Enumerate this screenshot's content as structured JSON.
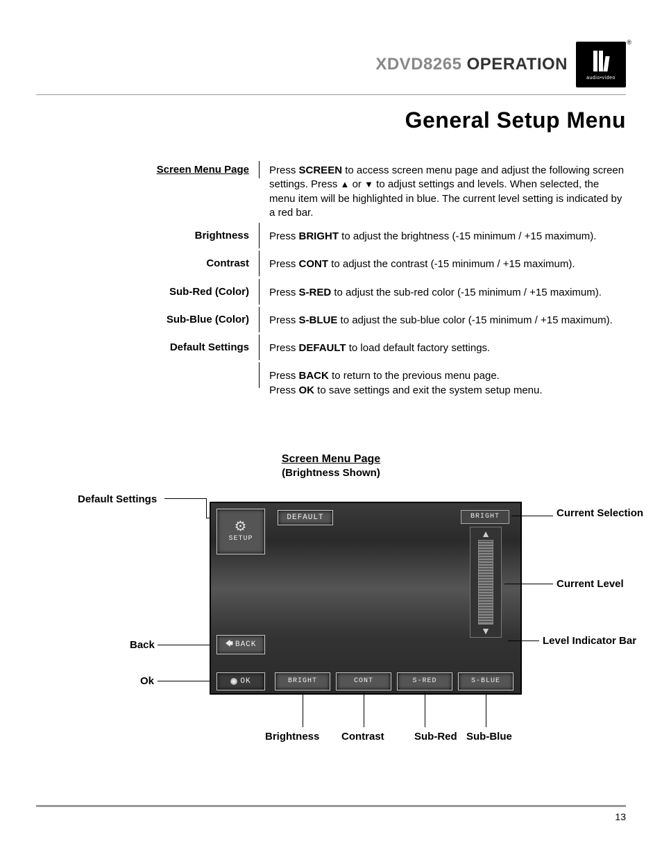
{
  "header": {
    "model": "XDVD8265",
    "section": "OPERATION",
    "logo_sub": "audio•video",
    "reg": "®"
  },
  "title": "General Setup Menu",
  "rows": [
    {
      "label": "Screen Menu Page",
      "underline": true,
      "body_html": "Press <b>SCREEN</b> to access screen menu page and adjust the following screen settings. Press <span class='arrow-glyph'>▲</span> or <span class='arrow-glyph'>▼</span> to adjust settings and levels. When selected, the menu item will be highlighted in blue. The current level setting is indicated by a red bar."
    },
    {
      "label": "Brightness",
      "body_html": "Press <b>BRIGHT</b> to adjust the brightness (-15 minimum / +15 maximum)."
    },
    {
      "label": "Contrast",
      "body_html": "Press <b>CONT</b> to adjust the contrast (-15 minimum / +15 maximum)."
    },
    {
      "label": "Sub-Red (Color)",
      "body_html": "Press <b>S-RED</b> to adjust the sub-red color (-15 minimum / +15 maximum)."
    },
    {
      "label": "Sub-Blue (Color)",
      "body_html": "Press <b>S-BLUE</b> to adjust the sub-blue color (-15 minimum / +15 maximum)."
    },
    {
      "label": "Default Settings",
      "body_html": "Press <b>DEFAULT</b> to load default factory settings."
    },
    {
      "label": "",
      "body_html": "Press <b>BACK</b> to return to the previous menu page.<br>Press <b>OK</b> to save settings and exit the system setup menu."
    }
  ],
  "diagram": {
    "title": "Screen Menu Page",
    "subtitle": "(Brightness Shown)",
    "buttons": {
      "setup": "SETUP",
      "default": "DEFAULT",
      "back": "BACK",
      "ok": "OK",
      "bright": "BRIGHT",
      "cont": "CONT",
      "sred": "S-RED",
      "sblue": "S-BLUE",
      "sel_label": "BRIGHT"
    },
    "callouts": {
      "default_settings": "Default Settings",
      "back": "Back",
      "ok": "Ok",
      "current_selection": "Current Selection",
      "current_level": "Current Level",
      "level_bar": "Level Indicator Bar",
      "brightness": "Brightness",
      "contrast": "Contrast",
      "sub_red": "Sub-Red",
      "sub_blue": "Sub-Blue"
    }
  },
  "page_number": "13"
}
